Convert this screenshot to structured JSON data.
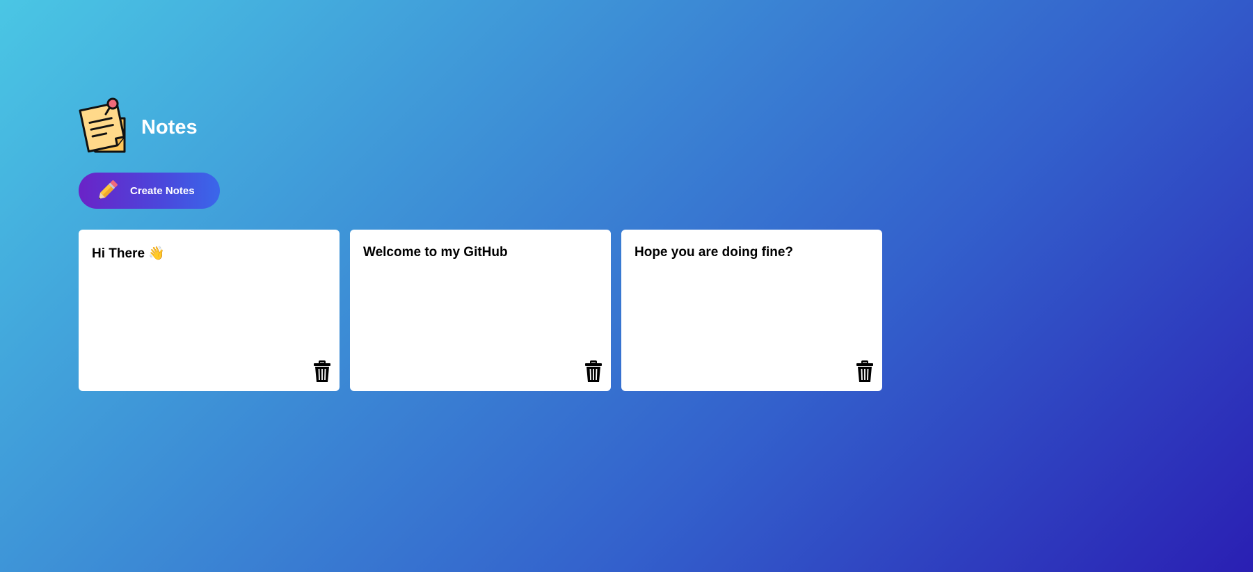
{
  "app": {
    "title": "Notes"
  },
  "toolbar": {
    "create_label": "Create Notes"
  },
  "notes": [
    {
      "text": "Hi There 👋"
    },
    {
      "text": "Welcome to my GitHub"
    },
    {
      "text": "Hope you are doing fine?"
    }
  ],
  "icons": {
    "logo": "sticky-note-pin-icon",
    "create": "pencil-icon",
    "delete": "trash-icon"
  },
  "colors": {
    "background_start": "#4ac6e4",
    "background_end": "#2a1fb3",
    "button_start": "#6a23c7",
    "button_end": "#3a67ea",
    "note_bg": "#ffffff",
    "note_pin": "#f06a7a",
    "note_paper": "#ffd27a"
  }
}
